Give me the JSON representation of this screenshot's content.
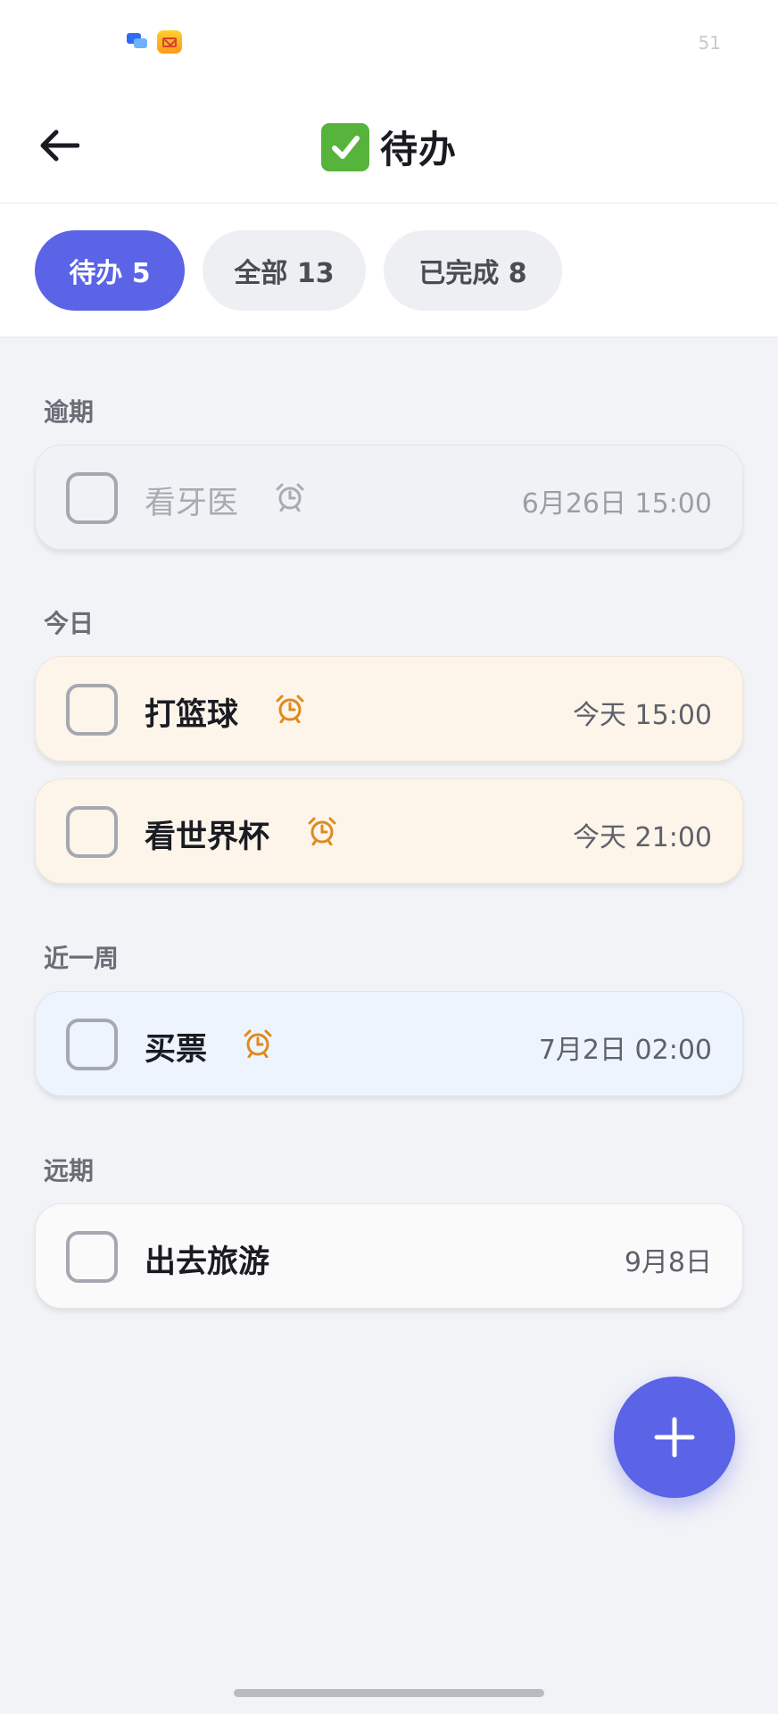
{
  "status_bar": {
    "battery": "51"
  },
  "header": {
    "title": "待办"
  },
  "tabs": [
    {
      "label": "待办 5",
      "active": true
    },
    {
      "label": "全部 13",
      "active": false
    },
    {
      "label": "已完成 8",
      "active": false
    }
  ],
  "sections": {
    "overdue": {
      "label": "逾期",
      "tasks": [
        {
          "title": "看牙医",
          "time": "6月26日 15:00",
          "alarm": true
        }
      ]
    },
    "today": {
      "label": "今日",
      "tasks": [
        {
          "title": "打篮球",
          "time": "今天 15:00",
          "alarm": true
        },
        {
          "title": "看世界杯",
          "time": "今天 21:00",
          "alarm": true
        }
      ]
    },
    "week": {
      "label": "近一周",
      "tasks": [
        {
          "title": "买票",
          "time": "7月2日 02:00",
          "alarm": true
        }
      ]
    },
    "later": {
      "label": "远期",
      "tasks": [
        {
          "title": "出去旅游",
          "time": "9月8日",
          "alarm": false
        }
      ]
    }
  },
  "colors": {
    "accent": "#5b63e6",
    "alarm_overdue": "#a9abb2",
    "alarm_active": "#e08a1e"
  },
  "icons": {
    "back": "arrow-left-icon",
    "title": "check-mark-button-icon",
    "alarm": "alarm-clock-icon",
    "add": "plus-icon"
  }
}
